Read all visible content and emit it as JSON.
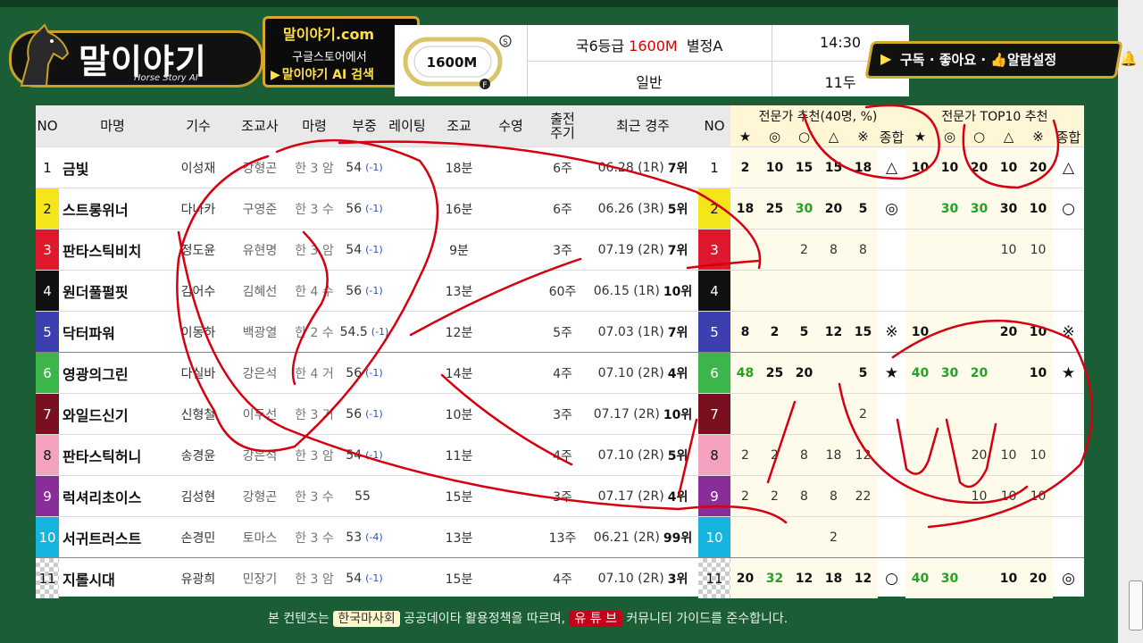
{
  "logo": {
    "title": "말이야기",
    "subtitle": "Horse Story AI"
  },
  "promo": {
    "line1": "말이야기.com",
    "line2": "구글스토어에서",
    "line3": "말이야기 AI 검색"
  },
  "track": {
    "label": "1600M",
    "start_marker": "S",
    "finish_marker": "F"
  },
  "race": {
    "grade": "국6등급",
    "distance": "1600M",
    "type": "별정A",
    "time": "14:30",
    "category": "일반",
    "count": "11두"
  },
  "subscribe": {
    "text": "구독 · 좋아요 · 👍알람설정"
  },
  "columns": {
    "no": "NO",
    "name": "마명",
    "jockey": "기수",
    "trainer": "조교사",
    "age": "마령",
    "weight": "부중",
    "rating": "레이팅",
    "training": "조교",
    "swim": "수영",
    "interval": "출전 주기",
    "recent": "최근 경주",
    "no2": "NO",
    "expert_group1": "전문가 추천(40명, %)",
    "expert_group2": "전문가 TOP10 추천",
    "expert_cols": [
      "★",
      "◎",
      "○",
      "△",
      "※",
      "종합",
      "★",
      "◎",
      "○",
      "△",
      "※",
      "종합"
    ]
  },
  "gate_colors": [
    "#ffffff",
    "#f5e51b",
    "#e0182d",
    "#111111",
    "#3b3fb0",
    "#3cb64a",
    "#7a0f1f",
    "#f4a2c0",
    "#8a2c9a",
    "#18b4e0",
    "#ffffff"
  ],
  "rows": [
    {
      "no": "1",
      "name": "금빛",
      "jockey": "이성재",
      "trainer": "강형곤",
      "age": "한 3 암",
      "weight": "54",
      "wchg": "(-1)",
      "training": "18분",
      "interval": "6주",
      "recent": "06.28 (1R)",
      "place": "7위",
      "e": [
        "2",
        "10",
        "15",
        "15",
        "18",
        "△",
        "10",
        "10",
        "20",
        "10",
        "20",
        "△"
      ]
    },
    {
      "no": "2",
      "name": "스트롱위너",
      "jockey": "다나카",
      "trainer": "구영준",
      "age": "한 3 수",
      "weight": "56",
      "wchg": "(-1)",
      "training": "16분",
      "interval": "6주",
      "recent": "06.26 (3R)",
      "place": "5위",
      "e": [
        "18",
        "25",
        "30",
        "20",
        "5",
        "◎",
        "",
        "30",
        "30",
        "30",
        "10",
        "○"
      ]
    },
    {
      "no": "3",
      "name": "판타스틱비치",
      "jockey": "정도윤",
      "trainer": "유현명",
      "age": "한 3 암",
      "weight": "54",
      "wchg": "(-1)",
      "training": "9분",
      "interval": "3주",
      "recent": "07.19 (2R)",
      "place": "7위",
      "e": [
        "",
        "",
        "2",
        "8",
        "8",
        "",
        "",
        "",
        "",
        "10",
        "10",
        ""
      ]
    },
    {
      "no": "4",
      "name": "원더풀펄핏",
      "jockey": "김어수",
      "trainer": "김혜선",
      "age": "한 4 수",
      "weight": "56",
      "wchg": "(-1)",
      "training": "13분",
      "interval": "60주",
      "recent": "06.15 (1R)",
      "place": "10위",
      "e": [
        "",
        "",
        "",
        "",
        "",
        "",
        "",
        "",
        "",
        "",
        "",
        ""
      ]
    },
    {
      "no": "5",
      "name": "닥터파워",
      "jockey": "이동하",
      "trainer": "백광열",
      "age": "한 2 수",
      "weight": "54.5",
      "wchg": "(-1)",
      "training": "12분",
      "interval": "5주",
      "recent": "07.03 (1R)",
      "place": "7위",
      "e": [
        "8",
        "2",
        "5",
        "12",
        "15",
        "※",
        "10",
        "",
        "",
        "20",
        "10",
        "※"
      ]
    },
    {
      "no": "6",
      "name": "영광의그린",
      "jockey": "다실바",
      "trainer": "강은석",
      "age": "한 4 거",
      "weight": "56",
      "wchg": "(-1)",
      "training": "14분",
      "interval": "4주",
      "recent": "07.10 (2R)",
      "place": "4위",
      "e": [
        "48",
        "25",
        "20",
        "",
        "5",
        "★",
        "40",
        "30",
        "20",
        "",
        "10",
        "★"
      ]
    },
    {
      "no": "7",
      "name": "와일드신기",
      "jockey": "신형철",
      "trainer": "이두선",
      "age": "한 3 거",
      "weight": "56",
      "wchg": "(-1)",
      "training": "10분",
      "interval": "3주",
      "recent": "07.17 (2R)",
      "place": "10위",
      "e": [
        "",
        "",
        "",
        "",
        "2",
        "",
        "",
        "",
        "",
        "",
        "",
        ""
      ]
    },
    {
      "no": "8",
      "name": "판타스틱허니",
      "jockey": "송경윤",
      "trainer": "강은석",
      "age": "한 3 암",
      "weight": "54",
      "wchg": "(-1)",
      "training": "11분",
      "interval": "4주",
      "recent": "07.10 (2R)",
      "place": "5위",
      "e": [
        "2",
        "2",
        "8",
        "18",
        "12",
        "",
        "",
        "",
        "20",
        "10",
        "10",
        ""
      ]
    },
    {
      "no": "9",
      "name": "럭셔리초이스",
      "jockey": "김성현",
      "trainer": "강형곤",
      "age": "한 3 수",
      "weight": "55",
      "wchg": "",
      "training": "15분",
      "interval": "3주",
      "recent": "07.17 (2R)",
      "place": "4위",
      "e": [
        "2",
        "2",
        "8",
        "8",
        "22",
        "",
        "",
        "",
        "10",
        "10",
        "10",
        ""
      ]
    },
    {
      "no": "10",
      "name": "서귀트러스트",
      "jockey": "손경민",
      "trainer": "토마스",
      "age": "한 3 수",
      "weight": "53",
      "wchg": "(-4)",
      "training": "13분",
      "interval": "13주",
      "recent": "06.21 (2R)",
      "place": "99위",
      "e": [
        "",
        "",
        "",
        "2",
        "",
        "",
        "",
        "",
        "",
        "",
        "",
        ""
      ]
    },
    {
      "no": "11",
      "name": "지롤시대",
      "jockey": "유광희",
      "trainer": "민장기",
      "age": "한 3 암",
      "weight": "54",
      "wchg": "(-1)",
      "training": "15분",
      "interval": "4주",
      "recent": "07.10 (2R)",
      "place": "3위",
      "e": [
        "20",
        "32",
        "12",
        "18",
        "12",
        "○",
        "40",
        "30",
        "",
        "10",
        "20",
        "◎"
      ]
    }
  ],
  "footer": {
    "pre": "본 컨텐츠는 ",
    "kra": "한국마사회",
    "mid": " 공공데이타 활용정책을 따르며, ",
    "yt": "유 튜 브",
    "post": " 커뮤니티 가이드를 준수합니다."
  }
}
